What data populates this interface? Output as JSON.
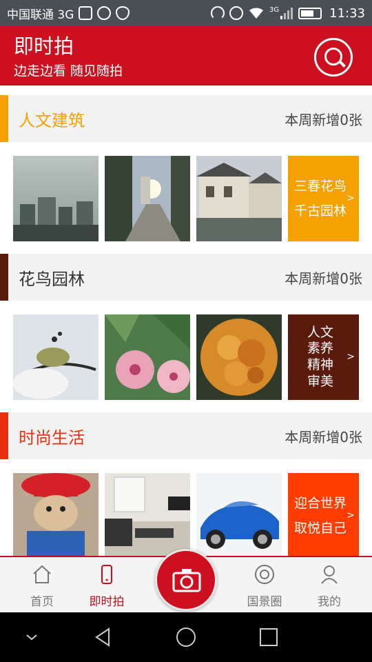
{
  "status": {
    "carrier": "中国联通 3G",
    "network_badge": "3G",
    "time": "11:33",
    "icons": [
      "image-icon",
      "headset-icon",
      "wifi-shield-icon",
      "headphones-icon",
      "alarm-icon",
      "wifi-icon",
      "signal-icon",
      "battery-icon"
    ]
  },
  "header": {
    "title": "即时拍",
    "subtitle": "边走边看 随见随拍",
    "search_icon": "search-icon",
    "color": "#cc1020"
  },
  "sections": [
    {
      "name": "人文建筑",
      "count": "本周新增0张",
      "color": "#f5a100",
      "promo": {
        "lines": [
          "三春花鸟",
          "千古园林"
        ],
        "arrow": ">",
        "color": "#f5a100"
      },
      "photos": [
        "city-skyline-photo",
        "sunset-street-photo",
        "old-town-photo"
      ]
    },
    {
      "name": "花鸟园林",
      "count": "本周新增0张",
      "color": "#5a1a0c",
      "promo": {
        "lines": [
          "人文",
          "素养",
          "精神",
          "审美"
        ],
        "arrow": ">",
        "color": "#5a1a0c"
      },
      "photos": [
        "bird-photo",
        "pink-flowers-photo",
        "marigold-photo"
      ]
    },
    {
      "name": "时尚生活",
      "count": "本周新增0张",
      "color": "#e83010",
      "promo": {
        "lines": [
          "迎合世界",
          "取悦自己"
        ],
        "arrow": ">",
        "color": "#ff3d00"
      },
      "photos": [
        "teddy-bear-photo",
        "living-room-photo",
        "blue-car-photo"
      ]
    }
  ],
  "tabs": [
    {
      "label": "首页",
      "icon": "home-icon",
      "active": false
    },
    {
      "label": "即时拍",
      "icon": "phone-icon",
      "active": true
    },
    {
      "label": "国景圈",
      "icon": "aperture-icon",
      "active": false
    },
    {
      "label": "我的",
      "icon": "user-icon",
      "active": false
    }
  ],
  "camera_icon": "camera-icon",
  "nav": [
    "collapse-icon",
    "back-icon",
    "home-circle-icon",
    "recents-icon"
  ]
}
